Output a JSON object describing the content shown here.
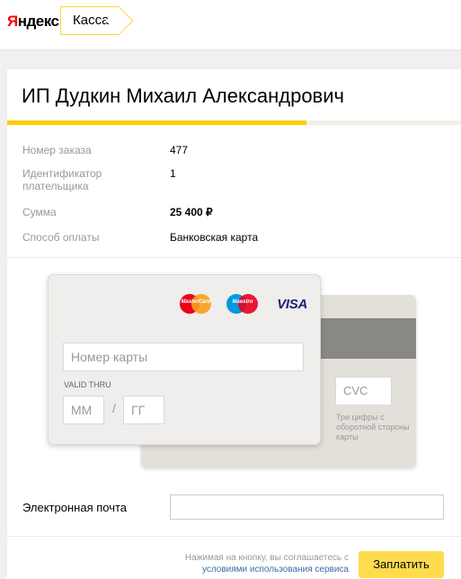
{
  "header": {
    "logo_text_first": "Я",
    "logo_text_rest": "ндекс",
    "service_tab": "Касса"
  },
  "merchant": {
    "name": "ИП Дудкин Михаил Александрович"
  },
  "progress": {
    "fraction": 0.66,
    "fill_color": "#ffcc00"
  },
  "order_info": {
    "rows": [
      {
        "label": "Номер заказа",
        "value": "477"
      },
      {
        "label": "Идентификатор плательщика",
        "value": "1"
      },
      {
        "label": "Сумма",
        "value": "25 400 ₽"
      },
      {
        "label": "Способ оплаты",
        "value": "Банковская карта"
      }
    ]
  },
  "card": {
    "brands": {
      "mastercard": "MasterCard",
      "maestro": "Maestro",
      "visa": "VISA"
    },
    "number_placeholder": "Номер карты",
    "valid_thru_label": "VALID THRU",
    "month_placeholder": "ММ",
    "slash": "/",
    "year_placeholder": "ГГ",
    "cvc_placeholder": "CVC",
    "cvc_hint": "Три цифры с оборотной стороны карты"
  },
  "email": {
    "label": "Электронная почта",
    "value": ""
  },
  "footer": {
    "agree_text": "Нажимая на кнопку, вы соглашаетесь с",
    "agree_link": "условиями использования сервиса",
    "pay_button": "Заплатить"
  },
  "colors": {
    "accent_yellow": "#ffdb4d",
    "link_blue": "#3a6ea5",
    "logo_red": "#ff0000"
  }
}
